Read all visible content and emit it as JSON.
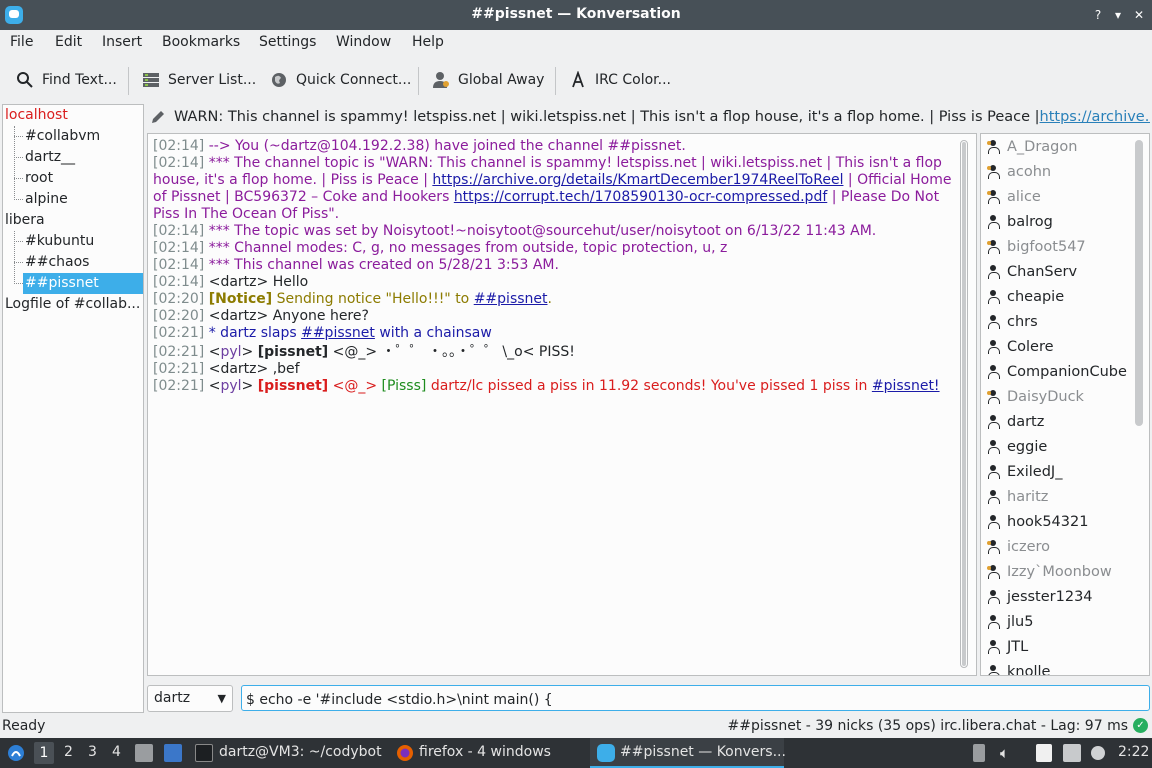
{
  "window": {
    "title": "##pissnet — Konversation"
  },
  "menu": [
    "File",
    "Edit",
    "Insert",
    "Bookmarks",
    "Settings",
    "Window",
    "Help"
  ],
  "toolbar": {
    "find": "Find Text...",
    "server_list": "Server List...",
    "quick_connect": "Quick Connect...",
    "global_away": "Global Away",
    "irc_color": "IRC Color..."
  },
  "tree": {
    "localhost": "localhost",
    "localhost_children": [
      "#collabvm",
      "dartz__",
      "root",
      "alpine"
    ],
    "libera": "libera",
    "libera_children": [
      "#kubuntu",
      "##chaos",
      "##pissnet"
    ],
    "logfile": "Logfile of #collab..."
  },
  "topic": {
    "text": "WARN: This channel is spammy! letspiss.net | wiki.letspiss.net | This isn't a flop house, it's a flop home. | Piss is Peace | ",
    "link": "https://archive.org/det..."
  },
  "chat": {
    "l1_ts": "[02:14]",
    "l1": " --> You (~dartz@104.192.2.38) have joined the channel ##pissnet.",
    "l2_ts": "[02:14]",
    "l2a": " *** The channel topic is \"WARN: This channel is spammy! letspiss.net | wiki.letspiss.net | This isn't a flop house, it's a flop home. | Piss is Peace | ",
    "l2_link1": "https://archive.org/details/KmartDecember1974ReelToReel",
    "l2b": " | Official Home of Pissnet | BC596372 – Coke and Hookers ",
    "l2_link2": "https://corrupt.tech/1708590130-ocr-compressed.pdf",
    "l2c": " | Please Do Not Piss In The Ocean Of Piss\".",
    "l3_ts": "[02:14]",
    "l3": " *** The topic was set by Noisytoot!~noisytoot@sourcehut/user/noisytoot on 6/13/22 11:43 AM.",
    "l4_ts": "[02:14]",
    "l4": " *** Channel modes: C, g, no messages from outside, topic protection, u, z",
    "l5_ts": "[02:14]",
    "l5": " *** This channel was created on 5/28/21 3:53 AM.",
    "l6_ts": "[02:14]",
    "l6": " <dartz> Hello",
    "l7_ts": "[02:20]",
    "l7_notice": "[Notice]",
    "l7": " Sending notice \"Hello!!!\" to ",
    "l7_link": "##pissnet",
    "l7_end": ".",
    "l8_ts": "[02:20]",
    "l8": " <dartz> Anyone here?",
    "l9_ts": "[02:21]",
    "l9a": " * dartz slaps ",
    "l9_link": "##pissnet",
    "l9b": " with a chainsaw",
    "l10_ts": "[02:21]",
    "l10_open": " <",
    "l10_nick": "pyl",
    "l10_close": "> ",
    "l10_bold": "[pissnet]",
    "l10": " <@_> ・゜゜ ・。。・゜゜ \\_o< PISS!",
    "l11_ts": "[02:21]",
    "l11": " <dartz> ,bef",
    "l12_ts": "[02:21]",
    "l12_open": " <",
    "l12_nick": "pyl",
    "l12_close": "> ",
    "l12_bold": "[pissnet]",
    "l12_mid": " <@_> ",
    "l12_bracket": "[Pisss]",
    "l12": " dartz/lc pissed a piss in 11.92 seconds! You've pissed 1 piss in ",
    "l12_link": "#pissnet!"
  },
  "nicks": [
    "A_Dragon",
    "acohn",
    "alice",
    "balrog",
    "bigfoot547",
    "ChanServ",
    "cheapie",
    "chrs",
    "Colere",
    "CompanionCube",
    "DaisyDuck",
    "dartz",
    "eggie",
    "ExiledJ_",
    "haritz",
    "hook54321",
    "iczero",
    "Izzy`Moonbow",
    "jesster1234",
    "jlu5",
    "JTL",
    "knolle"
  ],
  "nick_away": [
    true,
    true,
    true,
    false,
    true,
    false,
    false,
    false,
    false,
    false,
    true,
    false,
    false,
    false,
    true,
    false,
    true,
    true,
    false,
    false,
    false,
    false
  ],
  "nick_marker": [
    "#e0a030",
    "#e0a030",
    "#e0a030",
    "",
    "#e0a030",
    "",
    "",
    "",
    "",
    "",
    "#e0a030",
    "",
    "",
    "",
    "",
    "",
    "#e0a030",
    "#e0a030",
    "",
    "",
    "",
    ""
  ],
  "input": {
    "nick": "dartz",
    "text": "$ echo -e '#include <stdio.h>\\nint main() {"
  },
  "status": {
    "left": "Ready",
    "right": "##pissnet - 39 nicks (35 ops)  irc.libera.chat - Lag: 97 ms"
  },
  "taskbar": {
    "desktops": [
      "1",
      "2",
      "3",
      "4"
    ],
    "terminal": "dartz@VM3: ~/codybot",
    "firefox": "firefox - 4 windows",
    "konversation": "##pissnet — Konvers...",
    "clock": "2:22"
  },
  "colors": {
    "accent": "#3daee9",
    "titlebar": "#475057",
    "taskbar": "#2e3236",
    "server": "#d91d1d"
  }
}
